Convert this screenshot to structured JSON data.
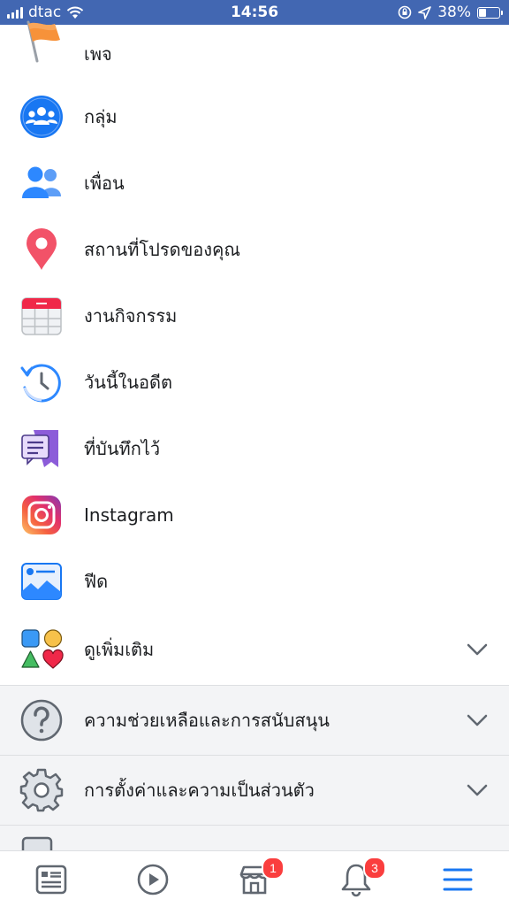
{
  "status_bar": {
    "carrier": "dtac",
    "time": "14:56",
    "battery": "38%",
    "battery_level": 0.38
  },
  "menu": {
    "items": [
      {
        "label": "เพจ",
        "icon": "flag-icon"
      },
      {
        "label": "กลุ่ม",
        "icon": "groups-icon"
      },
      {
        "label": "เพื่อน",
        "icon": "friends-icon"
      },
      {
        "label": "สถานที่โปรดของคุณ",
        "icon": "location-pin-icon"
      },
      {
        "label": "งานกิจกรรม",
        "icon": "calendar-icon"
      },
      {
        "label": "วันนี้ในอดีต",
        "icon": "memories-clock-icon"
      },
      {
        "label": "ที่บันทึกไว้",
        "icon": "saved-bookmark-icon"
      },
      {
        "label": "Instagram",
        "icon": "instagram-icon"
      },
      {
        "label": "ฟีด",
        "icon": "feed-icon"
      },
      {
        "label": "ดูเพิ่มเติม",
        "icon": "shapes-icon"
      }
    ],
    "help_label": "ความช่วยเหลือและการสนับสนุน",
    "settings_label": "การตั้งค่าและความเป็นส่วนตัว"
  },
  "tab_bar": {
    "marketplace_badge": "1",
    "notifications_badge": "3"
  },
  "colors": {
    "brand_blue": "#4267b2",
    "active_tab": "#1877f2",
    "badge_red": "#fa3e3e"
  }
}
